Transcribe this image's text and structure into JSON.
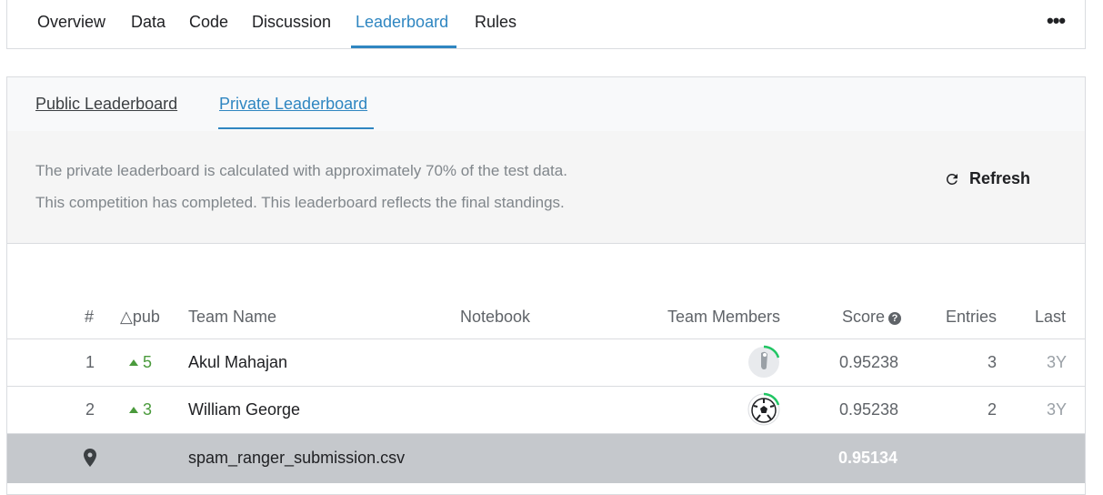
{
  "nav": {
    "tabs": [
      {
        "label": "Overview"
      },
      {
        "label": "Data"
      },
      {
        "label": "Code"
      },
      {
        "label": "Discussion"
      },
      {
        "label": "Leaderboard"
      },
      {
        "label": "Rules"
      }
    ],
    "active": "Leaderboard",
    "more_label": "•••"
  },
  "leaderboard": {
    "tabs": {
      "public": "Public Leaderboard",
      "private": "Private Leaderboard"
    },
    "active_tab": "private",
    "info_line_1": "The private leaderboard is calculated with approximately 70% of the test data.",
    "info_line_2": "This competition has completed. This leaderboard reflects the final standings.",
    "refresh_label": "Refresh",
    "columns": {
      "rank": "#",
      "delta": "△pub",
      "team": "Team Name",
      "notebook": "Notebook",
      "members": "Team Members",
      "score": "Score",
      "entries": "Entries",
      "last": "Last"
    },
    "rows": [
      {
        "rank": "1",
        "delta": "5",
        "team": "Akul Mahajan",
        "score": "0.95238",
        "entries": "3",
        "last": "3Y"
      },
      {
        "rank": "2",
        "delta": "3",
        "team": "William George",
        "score": "0.95238",
        "entries": "2",
        "last": "3Y"
      }
    ],
    "submission": {
      "file": "spam_ranger_submission.csv",
      "score": "0.95134"
    }
  },
  "colors": {
    "accent": "#2f86c1",
    "positive": "#4a9a3c",
    "submission_bg": "#c5c8cc"
  }
}
